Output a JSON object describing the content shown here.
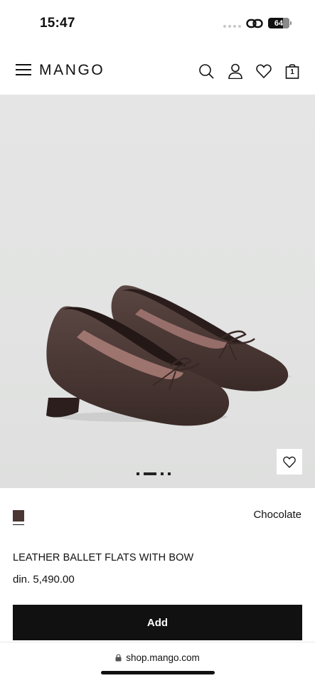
{
  "status_bar": {
    "time": "15:47",
    "battery": "64"
  },
  "header": {
    "logo": "MANGO",
    "bag_count": "1",
    "icons": [
      "menu-icon",
      "search-icon",
      "user-icon",
      "heart-icon",
      "bag-icon"
    ]
  },
  "gallery": {
    "image_count": 4,
    "active_index": 1
  },
  "product": {
    "color_name": "Chocolate",
    "swatch_color": "#4a3632",
    "title": "LEATHER BALLET FLATS WITH BOW",
    "price": "din. 5,490.00",
    "add_label": "Add"
  },
  "browser": {
    "url": "shop.mango.com"
  }
}
